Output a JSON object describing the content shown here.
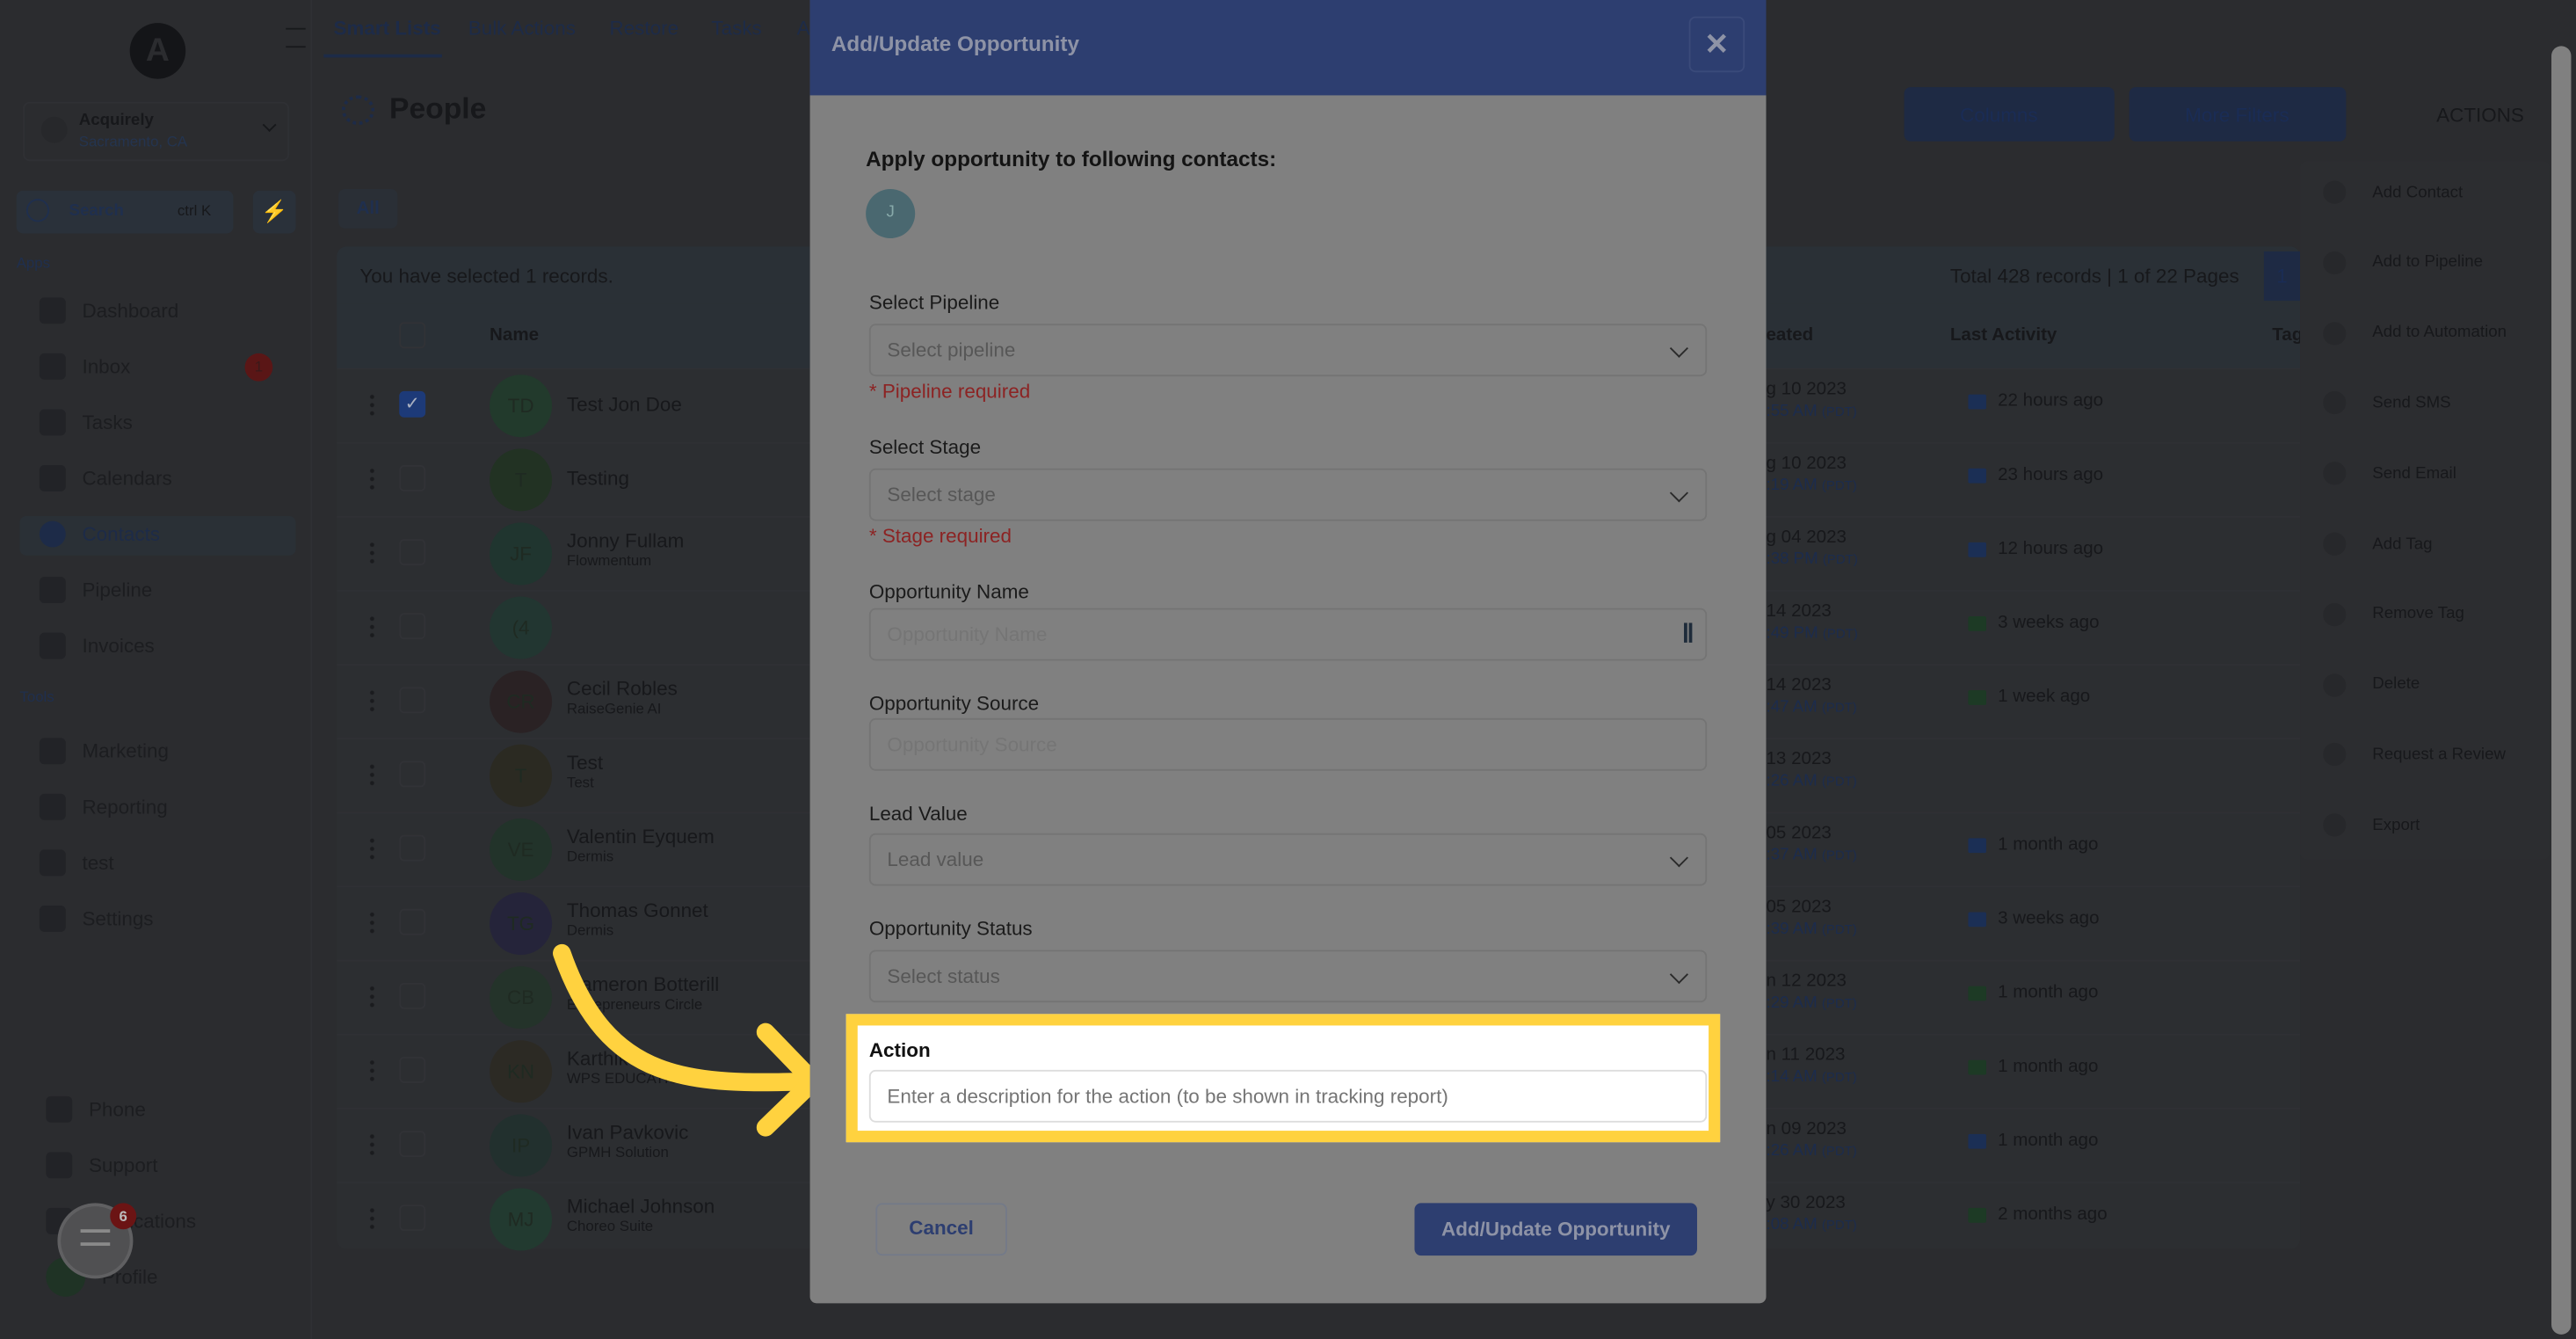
{
  "sidebar": {
    "account": {
      "name": "Acquirely",
      "location": "Sacramento, CA"
    },
    "search": {
      "placeholder": "Search",
      "shortcut": "ctrl K"
    },
    "apps_heading": "Apps",
    "tools_heading": "Tools",
    "apps": [
      {
        "label": "Dashboard"
      },
      {
        "label": "Inbox",
        "badge": "1"
      },
      {
        "label": "Tasks"
      },
      {
        "label": "Calendars"
      },
      {
        "label": "Contacts",
        "active": true
      },
      {
        "label": "Pipeline"
      },
      {
        "label": "Invoices"
      }
    ],
    "tools": [
      {
        "label": "Marketing"
      },
      {
        "label": "Reporting"
      },
      {
        "label": "test"
      },
      {
        "label": "Settings"
      }
    ],
    "bottom": [
      {
        "label": "Phone"
      },
      {
        "label": "Support"
      },
      {
        "label": "Notifications"
      },
      {
        "label": "Profile"
      }
    ],
    "chat_badge": "6"
  },
  "topnav": {
    "tabs": [
      "Smart Lists",
      "Bulk Actions",
      "Restore",
      "Tasks",
      "A"
    ],
    "active": "Smart Lists"
  },
  "page": {
    "title": "People",
    "filter_tab": "All",
    "selected_text": "You have selected 1 records.",
    "total_text": "Total 428 records | 1 of 22 Pages",
    "page_button": "1",
    "columns_button": "Columns",
    "filters_button": "More Filters",
    "actions_button": "ACTIONS"
  },
  "table": {
    "headers": {
      "name": "Name",
      "created": "eated",
      "last_activity": "Last Activity",
      "tags": "Tag"
    },
    "rows": [
      {
        "initials": "TD",
        "name": "Test Jon Doe",
        "company": "",
        "checked": true,
        "date": "g 10 2023",
        "time": ":55 AM",
        "tz": "(PDT)",
        "activity": "22 hours ago",
        "activity_type": "email",
        "color": "#223a2c"
      },
      {
        "initials": "T",
        "name": "Testing",
        "company": "",
        "date": "g 10 2023",
        "time": ":19 AM",
        "tz": "(PDT)",
        "activity": "23 hours ago",
        "activity_type": "email",
        "color": "#223223"
      },
      {
        "initials": "JF",
        "name": "Jonny Fullam",
        "company": "Flowmentum",
        "date": "g 04 2023",
        "time": ":38 PM",
        "tz": "(PDT)",
        "activity": "12 hours ago",
        "activity_type": "email",
        "color": "#20352f"
      },
      {
        "initials": "(4",
        "name": "",
        "company": "",
        "date": "14 2023",
        "time": ":49 PM",
        "tz": "(PDT)",
        "activity": "3 weeks ago",
        "activity_type": "sms",
        "color": "#223631"
      },
      {
        "initials": "CR",
        "name": "Cecil Robles",
        "company": "RaiseGenie AI",
        "date": "14 2023",
        "time": ":47 AM",
        "tz": "(PDT)",
        "activity": "1 week ago",
        "activity_type": "sms",
        "color": "#2a2224"
      },
      {
        "initials": "T",
        "name": "Test",
        "company": "Test",
        "date": "13 2023",
        "time": ":26 AM",
        "tz": "(PDT)",
        "activity": "",
        "activity_type": "",
        "color": "#2b2a22"
      },
      {
        "initials": "VE",
        "name": "Valentin Eyquem",
        "company": "Dermis",
        "date": "05 2023",
        "time": ":37 AM",
        "tz": "(PDT)",
        "activity": "1 month ago",
        "activity_type": "email",
        "color": "#22332a"
      },
      {
        "initials": "TG",
        "name": "Thomas Gonnet",
        "company": "Dermis",
        "date": "05 2023",
        "time": ":39 AM",
        "tz": "(PDT)",
        "activity": "3 weeks ago",
        "activity_type": "email",
        "color": "#25243a"
      },
      {
        "initials": "CB",
        "name": "Cameron Botterill",
        "company": "Entrepreneurs Circle",
        "date": "n 12 2023",
        "time": ":29 AM",
        "tz": "(PDT)",
        "activity": "1 month ago",
        "activity_type": "sms",
        "color": "#24332a"
      },
      {
        "initials": "KN",
        "name": "Karthik",
        "company": "WPS EDUCATION",
        "date": "n 11 2023",
        "time": ":14 AM",
        "tz": "(PDT)",
        "activity": "1 month ago",
        "activity_type": "sms",
        "color": "#2c2a24"
      },
      {
        "initials": "IP",
        "name": "Ivan Pavkovic",
        "company": "GPMH Solution",
        "date": "n 09 2023",
        "time": ":26 AM",
        "tz": "(PDT)",
        "activity": "1 month ago",
        "activity_type": "email",
        "color": "#22302e"
      },
      {
        "initials": "MJ",
        "name": "Michael Johnson",
        "company": "Choreo Suite",
        "date": "y 30 2023",
        "time": ":08 AM",
        "tz": "(PDT)",
        "activity": "2 months ago",
        "activity_type": "sms",
        "color": "#223a30"
      }
    ]
  },
  "actions_menu": [
    "Add Contact",
    "Add to Pipeline",
    "Add to Automation",
    "Send SMS",
    "Send Email",
    "Add Tag",
    "Remove Tag",
    "Delete",
    "Request a Review",
    "Export"
  ],
  "modal": {
    "title": "Add/Update Opportunity",
    "apply_heading": "Apply opportunity to following contacts:",
    "contact_initial": "J",
    "pipeline": {
      "label": "Select Pipeline",
      "placeholder": "Select pipeline",
      "error": "* Pipeline required"
    },
    "stage": {
      "label": "Select Stage",
      "placeholder": "Select stage",
      "error": "* Stage required"
    },
    "opp_name": {
      "label": "Opportunity Name",
      "placeholder": "Opportunity Name"
    },
    "opp_source": {
      "label": "Opportunity Source",
      "placeholder": "Opportunity Source"
    },
    "lead_value": {
      "label": "Lead Value",
      "placeholder": "Lead value"
    },
    "status": {
      "label": "Opportunity Status",
      "placeholder": "Select status"
    },
    "action": {
      "label": "Action",
      "placeholder": "Enter a description for the action (to be shown in tracking report)"
    },
    "cancel": "Cancel",
    "submit": "Add/Update Opportunity"
  },
  "colors": {
    "highlight": "#ffd23f",
    "primary": "#2d3e70",
    "error": "#8c2323"
  }
}
